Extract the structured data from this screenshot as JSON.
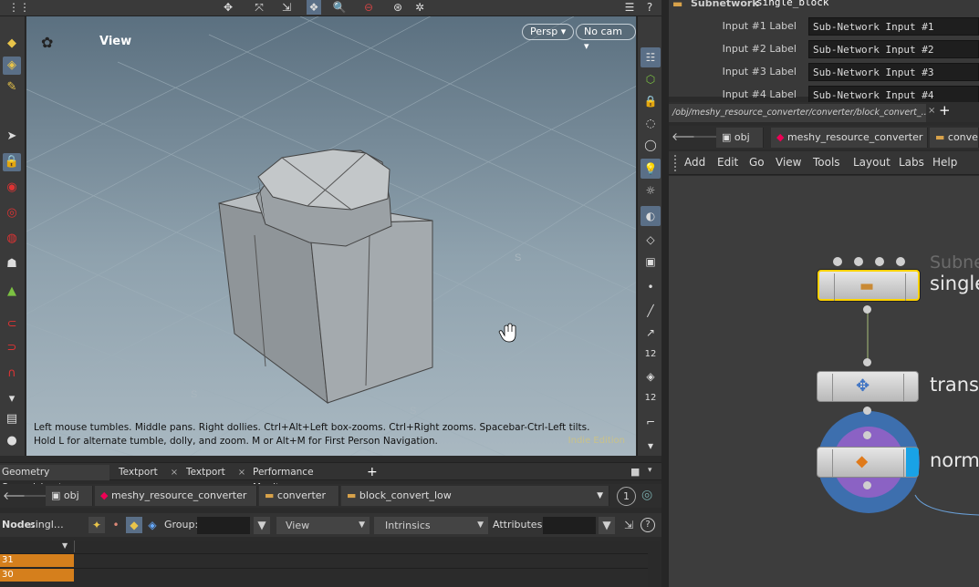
{
  "viewport": {
    "title": "View",
    "persp_label": "Persp",
    "cam_label": "No cam",
    "hint": "Left mouse tumbles. Middle pans. Right dollies. Ctrl+Alt+Left box-zooms. Ctrl+Right zooms. Spacebar-Ctrl-Left tilts. Hold L for alternate tumble, dolly, and zoom. M or Alt+M for First Person Navigation.",
    "edition": "Indie Edition"
  },
  "pane_tabs": [
    {
      "label": "Geometry Spreadsheet"
    },
    {
      "label": "Textport"
    },
    {
      "label": "Textport"
    },
    {
      "label": "Performance Monitor"
    }
  ],
  "tab_close": "×",
  "tab_add": "+",
  "path": {
    "crumbs": [
      "obj",
      "meshy_resource_converter",
      "converter",
      "block_convert_low"
    ],
    "pin": "1"
  },
  "spreadsheet": {
    "node_label": "Node:",
    "node_value": "singl…",
    "group_label": "Group:",
    "view_label": "View",
    "intrinsics_label": "Intrinsics",
    "attributes_label": "Attributes:",
    "rows": [
      "31",
      "30"
    ]
  },
  "params": {
    "top_label": "Subnetwork",
    "top_value": "single_block",
    "inputs": [
      {
        "label": "Input #1 Label",
        "value": "Sub-Network Input #1"
      },
      {
        "label": "Input #2 Label",
        "value": "Sub-Network Input #2"
      },
      {
        "label": "Input #3 Label",
        "value": "Sub-Network Input #3"
      },
      {
        "label": "Input #4 Label",
        "value": "Sub-Network Input #4"
      }
    ]
  },
  "network": {
    "tab_path": "/obj/meshy_resource_converter/converter/block_convert_...",
    "crumbs": [
      "obj",
      "meshy_resource_converter",
      "conve"
    ],
    "menus": [
      "Add",
      "Edit",
      "Go",
      "View",
      "Tools",
      "Layout",
      "Labs",
      "Help"
    ],
    "nodes": [
      {
        "type_label": "Subne",
        "name": "single"
      },
      {
        "name": "trans"
      },
      {
        "name": "norm"
      }
    ]
  },
  "colors": {
    "accent": "#d57f1c",
    "selected_node": "#ffd200",
    "node_ring": "#3d6fae",
    "node_inner": "#8b62c4"
  }
}
